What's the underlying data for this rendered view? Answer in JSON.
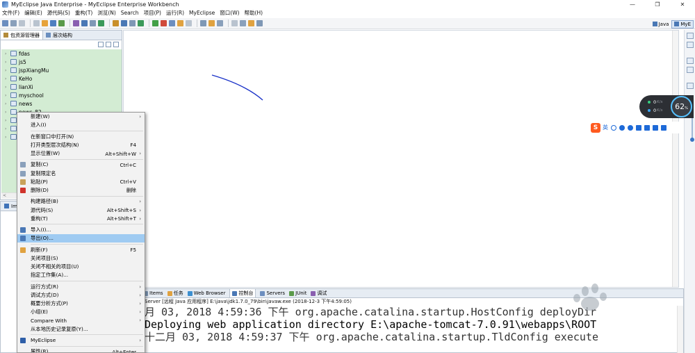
{
  "window": {
    "app_title": "MyEclipse Java Enterprise",
    "title": "MyEclipse Java Enterprise - MyEclipse Enterprise Workbench",
    "minimize": "—",
    "restore": "❐",
    "close": "✕"
  },
  "menubar": {
    "items": [
      "文件(F)",
      "编辑(E)",
      "源代码(S)",
      "重构(T)",
      "浏览(N)",
      "Search",
      "项目(P)",
      "运行(R)",
      "MyEclipse",
      "窗口(W)",
      "帮助(H)"
    ]
  },
  "perspectives": {
    "java": "Java",
    "myeclipse": "MyE"
  },
  "explorer": {
    "tab_active": "包资源管理器",
    "tab_other": "层次结构",
    "projects": [
      "fdas",
      "js5",
      "jspXiangMu",
      "KeHo",
      "lianXi",
      "myschool",
      "news",
      "news_82"
    ],
    "scroll_left": "<"
  },
  "outline": {
    "tab": "Im"
  },
  "context_menu": {
    "items": [
      {
        "label": "新建(W)",
        "shortcut": "",
        "submenu": true,
        "icon": ""
      },
      {
        "label": "进入(I)",
        "shortcut": "",
        "submenu": false,
        "icon": ""
      },
      {
        "sep": true
      },
      {
        "label": "在新窗口中打开(N)",
        "shortcut": "",
        "submenu": false,
        "icon": ""
      },
      {
        "label": "打开类型层次结构(N)",
        "shortcut": "F4",
        "submenu": false,
        "icon": ""
      },
      {
        "label": "显示位置(W)",
        "shortcut": "Alt+Shift+W",
        "submenu": true,
        "icon": ""
      },
      {
        "sep": true
      },
      {
        "label": "复制(C)",
        "shortcut": "Ctrl+C",
        "submenu": false,
        "icon": "copy-icon"
      },
      {
        "label": "复制限定名",
        "shortcut": "",
        "submenu": false,
        "icon": "copy-qualified-icon"
      },
      {
        "label": "粘贴(P)",
        "shortcut": "Ctrl+V",
        "submenu": false,
        "icon": "paste-icon"
      },
      {
        "label": "删除(D)",
        "shortcut": "删除",
        "submenu": false,
        "icon": "delete-icon"
      },
      {
        "sep": true
      },
      {
        "label": "构建路径(B)",
        "shortcut": "",
        "submenu": true,
        "icon": ""
      },
      {
        "label": "源代码(S)",
        "shortcut": "Alt+Shift+S",
        "submenu": true,
        "icon": ""
      },
      {
        "label": "重构(T)",
        "shortcut": "Alt+Shift+T",
        "submenu": true,
        "icon": ""
      },
      {
        "sep": true
      },
      {
        "label": "导入(I)...",
        "shortcut": "",
        "submenu": false,
        "icon": "import-icon"
      },
      {
        "label": "导出(O)...",
        "shortcut": "",
        "submenu": false,
        "icon": "export-icon",
        "highlighted": true
      },
      {
        "sep": true
      },
      {
        "label": "刷新(F)",
        "shortcut": "F5",
        "submenu": false,
        "icon": "refresh-icon"
      },
      {
        "label": "关闭项目(S)",
        "shortcut": "",
        "submenu": false,
        "icon": ""
      },
      {
        "label": "关闭不相关的项目(U)",
        "shortcut": "",
        "submenu": false,
        "icon": ""
      },
      {
        "label": "指定工作集(A)...",
        "shortcut": "",
        "submenu": false,
        "icon": ""
      },
      {
        "sep": true
      },
      {
        "label": "运行方式(R)",
        "shortcut": "",
        "submenu": true,
        "icon": ""
      },
      {
        "label": "调试方式(D)",
        "shortcut": "",
        "submenu": true,
        "icon": ""
      },
      {
        "label": "概要分析方式(P)",
        "shortcut": "",
        "submenu": true,
        "icon": ""
      },
      {
        "label": "小组(E)",
        "shortcut": "",
        "submenu": true,
        "icon": ""
      },
      {
        "label": "Compare With",
        "shortcut": "",
        "submenu": true,
        "icon": ""
      },
      {
        "label": "从本地历史记录复原(Y)...",
        "shortcut": "",
        "submenu": false,
        "icon": ""
      },
      {
        "sep": true
      },
      {
        "label": "MyEclipse",
        "shortcut": "",
        "submenu": true,
        "icon": "myeclipse-icon"
      },
      {
        "sep": true
      },
      {
        "label": "属性(R)",
        "shortcut": "Alt+Enter",
        "submenu": false,
        "icon": ""
      }
    ]
  },
  "console": {
    "tabs": [
      "Items",
      "任务",
      "Web Browser",
      "控制台",
      "Servers",
      "JUnit",
      "调试"
    ],
    "active_tab": "控制台",
    "header": "Server [远程 Java 应用程序] E:\\java\\jdk1.7.0_79\\bin\\javaw.exe (2018-12-3 下午4:59:05)",
    "lines": [
      "月 03, 2018 4:59:36 下午 org.apache.catalina.startup.HostConfig deployDir",
      "Deploying web application directory E:\\apache-tomcat-7.0.91\\webapps\\ROOT",
      "十二月 03, 2018 4:59:37 下午 org.apache.catalina.startup.TldConfig execute"
    ]
  },
  "speed_widget": {
    "up": "0",
    "down": "0",
    "unit": "K/s",
    "percent": "62",
    "percent_unit": "%"
  },
  "ime": {
    "logo": "S",
    "mode": "英"
  },
  "colors": {
    "tree_bg": "#d3ecd3",
    "menu_highlight": "#9fcbf2",
    "annotation": "#1a32c8"
  }
}
